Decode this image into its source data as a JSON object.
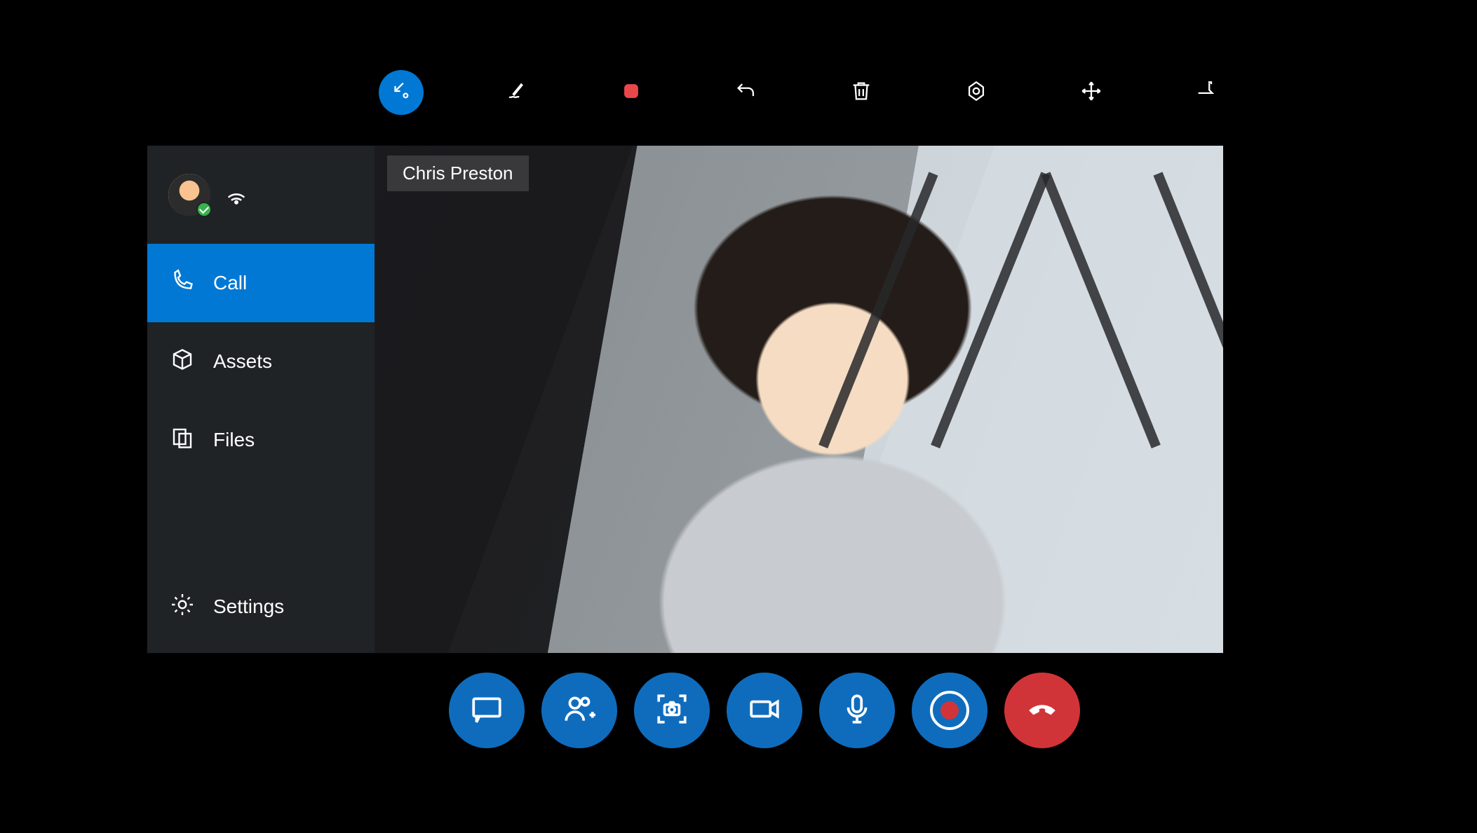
{
  "participant_name": "Chris Preston",
  "sidebar": {
    "items": [
      {
        "label": "Call",
        "icon": "phone-icon",
        "active": true
      },
      {
        "label": "Assets",
        "icon": "package-icon",
        "active": false
      },
      {
        "label": "Files",
        "icon": "files-icon",
        "active": false
      }
    ],
    "settings_label": "Settings"
  },
  "top_toolbar": {
    "items": [
      {
        "icon": "collapse-icon",
        "active": true
      },
      {
        "icon": "ink-icon",
        "active": false
      },
      {
        "icon": "stop-icon",
        "active": false
      },
      {
        "icon": "undo-icon",
        "active": false
      },
      {
        "icon": "trash-icon",
        "active": false
      },
      {
        "icon": "target-icon",
        "active": false
      },
      {
        "icon": "move-icon",
        "active": false
      },
      {
        "icon": "pin-icon",
        "active": false
      }
    ]
  },
  "call_bar": {
    "items": [
      {
        "icon": "chat-icon",
        "color": "blue"
      },
      {
        "icon": "add-people-icon",
        "color": "blue"
      },
      {
        "icon": "snapshot-icon",
        "color": "blue"
      },
      {
        "icon": "video-icon",
        "color": "blue"
      },
      {
        "icon": "mic-icon",
        "color": "blue"
      },
      {
        "icon": "record-icon",
        "color": "blue"
      },
      {
        "icon": "hangup-icon",
        "color": "red"
      }
    ]
  },
  "colors": {
    "accent": "#0078d4",
    "danger": "#d13438",
    "presence_available": "#37b24d"
  }
}
